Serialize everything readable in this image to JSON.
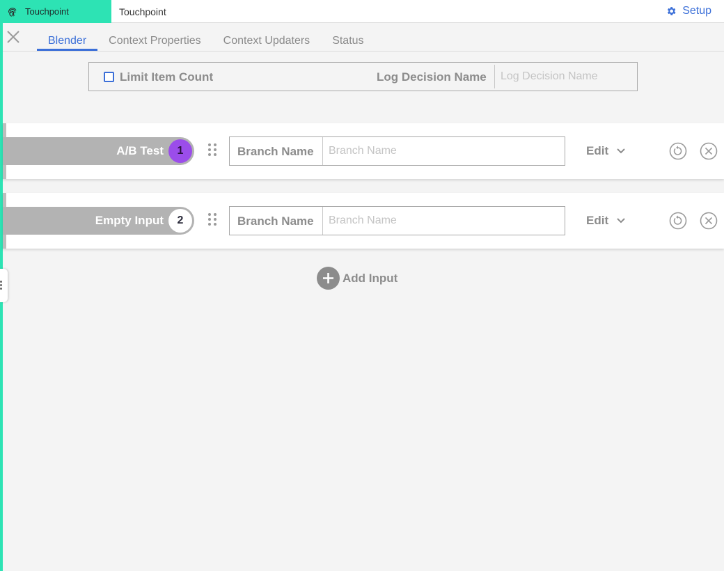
{
  "topbar": {
    "app_tab_label": "Touchpoint",
    "breadcrumb": "Touchpoint",
    "setup_label": "Setup"
  },
  "tabs": [
    {
      "label": "Blender",
      "active": true
    },
    {
      "label": "Context Properties",
      "active": false
    },
    {
      "label": "Context Updaters",
      "active": false
    },
    {
      "label": "Status",
      "active": false
    }
  ],
  "options": {
    "limit_item_count_label": "Limit Item Count",
    "limit_item_count_checked": false,
    "log_decision_label": "Log Decision Name",
    "log_decision_placeholder": "Log Decision Name",
    "log_decision_value": ""
  },
  "inputs": [
    {
      "name": "A/B Test",
      "number": "1",
      "branch_label": "Branch Name",
      "branch_placeholder": "Branch Name",
      "branch_value": "",
      "edit_label": "Edit"
    },
    {
      "name": "Empty Input",
      "number": "2",
      "branch_label": "Branch Name",
      "branch_placeholder": "Branch Name",
      "branch_value": "",
      "edit_label": "Edit"
    }
  ],
  "add_input_label": "Add Input",
  "colors": {
    "accent_teal": "#2de3b4",
    "link_blue": "#3b6fd8",
    "badge_purple": "#9b4dea",
    "muted_gray": "#8c8c8c"
  },
  "icons": [
    "fingerprint-icon",
    "gear-icon",
    "close-icon",
    "drag-handle-icon",
    "chevron-down-icon",
    "reset-icon",
    "remove-icon",
    "plus-icon",
    "side-panel-handle-icon"
  ]
}
